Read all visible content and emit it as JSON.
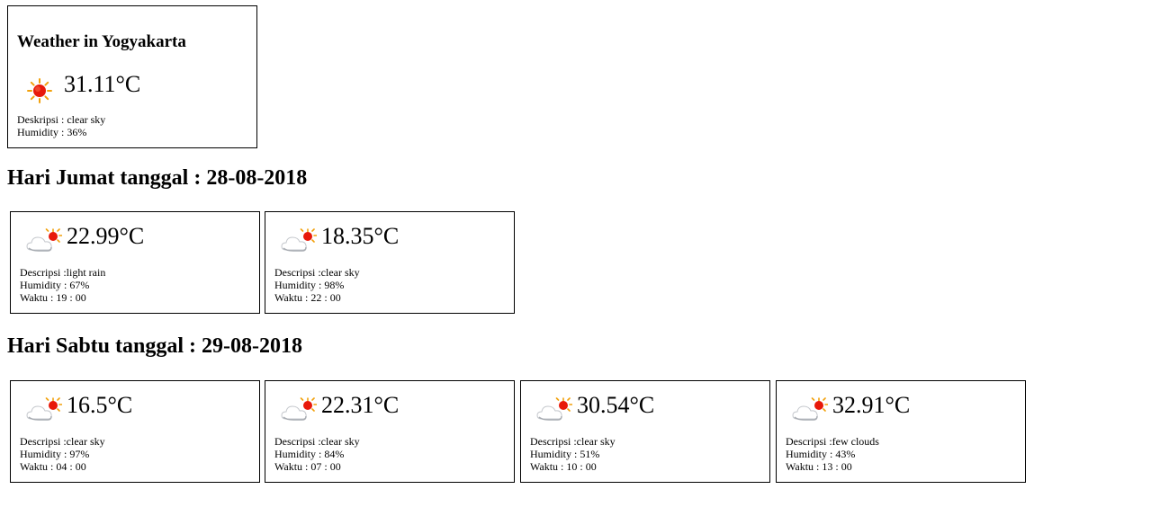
{
  "current": {
    "title": "Weather in Yogyakarta",
    "icon": "sun-icon",
    "temperature": "31.11°C",
    "description_line": "Deskripsi : clear sky",
    "humidity_line": "Humidity : 36%"
  },
  "days": [
    {
      "heading": "Hari Jumat tanggal : 28-08-2018",
      "forecasts": [
        {
          "icon": "partly-cloudy-icon",
          "temperature": "22.99°C",
          "description_line": "Descripsi :light rain",
          "humidity_line": "Humidity : 67%",
          "time_line": "Waktu : 19 : 00"
        },
        {
          "icon": "partly-cloudy-icon",
          "temperature": "18.35°C",
          "description_line": "Descripsi :clear sky",
          "humidity_line": "Humidity : 98%",
          "time_line": "Waktu : 22 : 00"
        }
      ]
    },
    {
      "heading": "Hari Sabtu tanggal : 29-08-2018",
      "forecasts": [
        {
          "icon": "partly-cloudy-icon",
          "temperature": "16.5°C",
          "description_line": "Descripsi :clear sky",
          "humidity_line": "Humidity : 97%",
          "time_line": "Waktu : 04 : 00"
        },
        {
          "icon": "partly-cloudy-icon",
          "temperature": "22.31°C",
          "description_line": "Descripsi :clear sky",
          "humidity_line": "Humidity : 84%",
          "time_line": "Waktu : 07 : 00"
        },
        {
          "icon": "partly-cloudy-icon",
          "temperature": "30.54°C",
          "description_line": "Descripsi :clear sky",
          "humidity_line": "Humidity : 51%",
          "time_line": "Waktu : 10 : 00"
        },
        {
          "icon": "partly-cloudy-icon",
          "temperature": "32.91°C",
          "description_line": "Descripsi :few clouds",
          "humidity_line": "Humidity : 43%",
          "time_line": "Waktu : 13 : 00"
        }
      ]
    }
  ],
  "colors": {
    "sun_core": "#e8190a",
    "sun_rays": "#f2a10c",
    "cloud_light": "#ffffff",
    "cloud_shade": "#b9bcc2"
  }
}
